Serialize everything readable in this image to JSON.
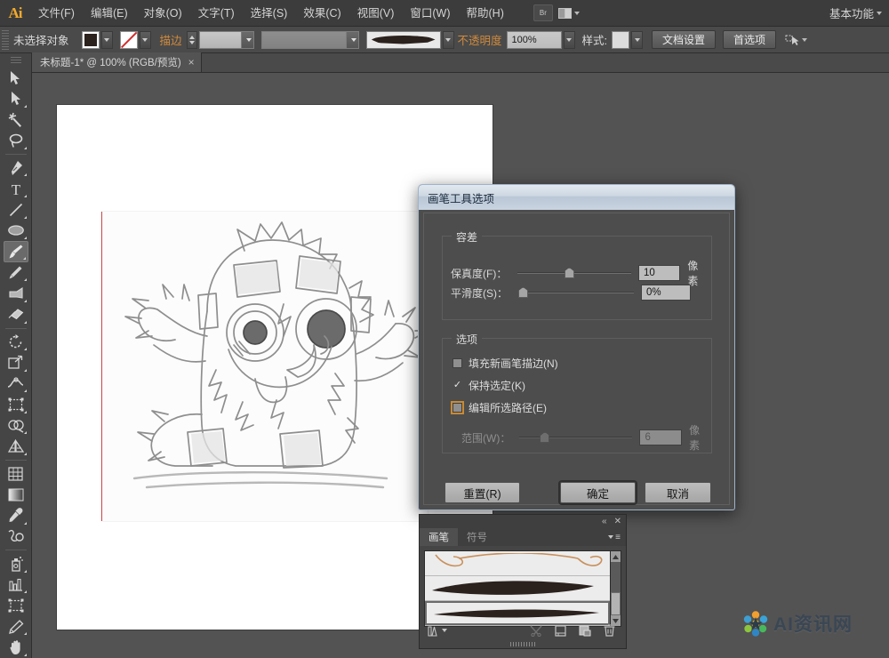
{
  "app": {
    "name": "Ai"
  },
  "menubar": {
    "items": [
      {
        "label": "文件(F)"
      },
      {
        "label": "编辑(E)"
      },
      {
        "label": "对象(O)"
      },
      {
        "label": "文字(T)"
      },
      {
        "label": "选择(S)"
      },
      {
        "label": "效果(C)"
      },
      {
        "label": "视图(V)"
      },
      {
        "label": "窗口(W)"
      },
      {
        "label": "帮助(H)"
      }
    ],
    "bridge_label": "Br",
    "workspace": "基本功能"
  },
  "controlbar": {
    "selection_status": "未选择对象",
    "fill_color": "#2b211d",
    "stroke_none": true,
    "stroke_label": "描边",
    "stroke_weight": "",
    "stroke_profile": "",
    "brush_definition": "",
    "opacity_label": "不透明度",
    "opacity_value": "100%",
    "style_label": "样式:",
    "document_setup_button": "文档设置",
    "preferences_button": "首选项"
  },
  "tabbar": {
    "tabs": [
      {
        "title": "未标题-1* @ 100% (RGB/预览)",
        "close": "×",
        "active": true
      }
    ]
  },
  "toolbar": {
    "tools": [
      {
        "name": "selection-tool",
        "active": false
      },
      {
        "name": "direct-selection-tool",
        "active": false
      },
      {
        "name": "magic-wand-tool",
        "active": false
      },
      {
        "name": "lasso-tool",
        "active": false
      },
      {
        "name": "pen-tool",
        "active": false
      },
      {
        "name": "type-tool",
        "active": false
      },
      {
        "name": "line-segment-tool",
        "active": false
      },
      {
        "name": "ellipse-tool",
        "active": false
      },
      {
        "name": "paintbrush-tool",
        "active": true
      },
      {
        "name": "pencil-tool",
        "active": false
      },
      {
        "name": "blob-brush-tool",
        "active": false
      },
      {
        "name": "eraser-tool",
        "active": false
      },
      {
        "name": "rotate-tool",
        "active": false
      },
      {
        "name": "scale-tool",
        "active": false
      },
      {
        "name": "width-tool",
        "active": false
      },
      {
        "name": "free-transform-tool",
        "active": false
      },
      {
        "name": "shape-builder-tool",
        "active": false
      },
      {
        "name": "perspective-grid-tool",
        "active": false
      },
      {
        "name": "mesh-tool",
        "active": false
      },
      {
        "name": "gradient-tool",
        "active": false
      },
      {
        "name": "eyedropper-tool",
        "active": false
      },
      {
        "name": "blend-tool",
        "active": false
      },
      {
        "name": "symbol-sprayer-tool",
        "active": false
      },
      {
        "name": "column-graph-tool",
        "active": false
      },
      {
        "name": "artboard-tool",
        "active": false
      },
      {
        "name": "slice-tool",
        "active": false
      },
      {
        "name": "hand-tool",
        "active": false
      }
    ]
  },
  "canvas": {
    "artwork_description": "铅笔素描：毛茸茸的卡通怪物"
  },
  "dialog": {
    "title": "画笔工具选项",
    "tolerance_group": {
      "title": "容差",
      "fidelity": {
        "label": "保真度(F)：",
        "value": "10",
        "unit": "像素",
        "slider_pct": 45
      },
      "smoothness": {
        "label": "平滑度(S)：",
        "value": "0%",
        "unit": "",
        "slider_pct": 0
      }
    },
    "options_group": {
      "title": "选项",
      "fill_new_brush_strokes": {
        "label": "填充新画笔描边(N)",
        "checked": false
      },
      "keep_selected": {
        "label": "保持选定(K)",
        "checked": true,
        "mark": "✓"
      },
      "edit_selected_paths": {
        "label": "编辑所选路径(E)",
        "checked": false,
        "focused": true
      },
      "within": {
        "label": "范围(W)：",
        "value": "6",
        "unit": "像素",
        "slider_pct": 18,
        "disabled": true
      }
    },
    "buttons": {
      "reset": "重置(R)",
      "ok": "确定",
      "cancel": "取消"
    }
  },
  "brushes_panel": {
    "collapse_icon": "«",
    "close_icon": "✕",
    "menu_icon": "≡",
    "tabs": [
      {
        "label": "画笔",
        "active": true
      },
      {
        "label": "符号",
        "active": false
      }
    ],
    "items": [
      {
        "name": "brush-stroke-calligraphic",
        "selected": false
      },
      {
        "name": "brush-stroke-tapered-thick",
        "selected": false
      },
      {
        "name": "brush-stroke-tapered-thin",
        "selected": true
      }
    ],
    "footer_icons": [
      {
        "name": "brush-libraries-menu-icon",
        "glyph": "⌁",
        "disabled": false
      },
      {
        "name": "remove-brush-stroke-icon",
        "glyph": "✂",
        "disabled": true
      },
      {
        "name": "options-of-selected-object-icon",
        "glyph": "▤",
        "disabled": false
      },
      {
        "name": "new-brush-icon",
        "glyph": "❐",
        "disabled": false
      },
      {
        "name": "delete-brush-icon",
        "glyph": "🗑",
        "disabled": false
      }
    ]
  },
  "watermark": {
    "text": "AI资讯网"
  }
}
